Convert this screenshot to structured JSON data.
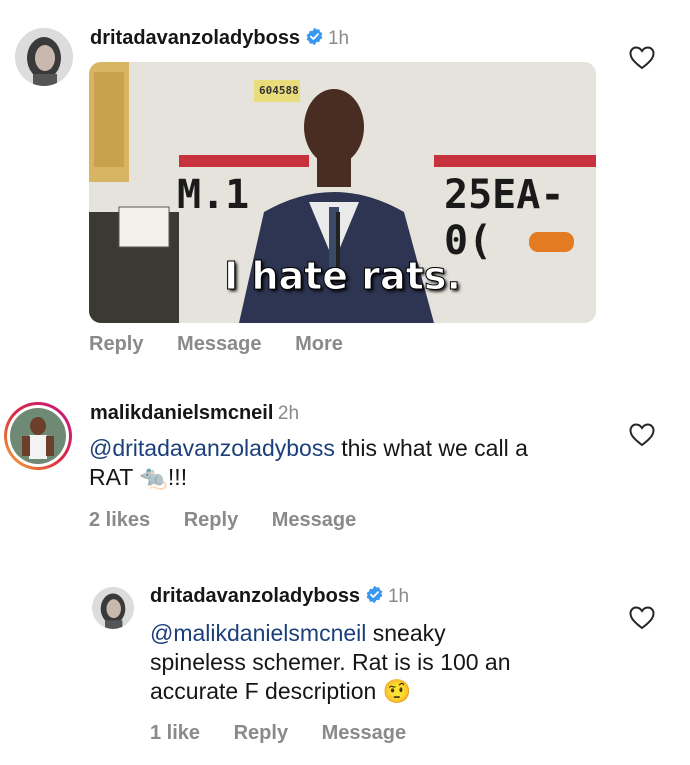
{
  "comments": [
    {
      "username": "dritadavanzoladyboss",
      "verified": true,
      "time": "1h",
      "gif": {
        "caption": "I hate rats.",
        "truck_left": "M.1",
        "truck_right": "25EA-0(",
        "plate": "604588"
      },
      "actions": [
        "Reply",
        "Message",
        "More"
      ]
    },
    {
      "username": "malikdanielsmcneil",
      "time": "2h",
      "mention": "@dritadavanzoladyboss",
      "text_line1": " this what we call a",
      "text_line2": "RAT",
      "text_emoji": "🐀",
      "text_suffix": "!!!",
      "likes": "2 likes",
      "actions": [
        "Reply",
        "Message"
      ]
    },
    {
      "username": "dritadavanzoladyboss",
      "verified": true,
      "time": "1h",
      "mention": "@malikdanielsmcneil",
      "text_line1": " sneaky",
      "text_line2": "spineless schemer. Rat is is 100 an",
      "text_line3": "accurate F description",
      "text_emoji": "🤨",
      "likes": "1 like",
      "actions": [
        "Reply",
        "Message"
      ]
    }
  ],
  "colors": {
    "accent_blue": "#3897f0",
    "mention": "#1b3f7a",
    "muted": "#8a8a8a"
  },
  "icons": [
    "heart-icon",
    "verified-badge-icon"
  ]
}
